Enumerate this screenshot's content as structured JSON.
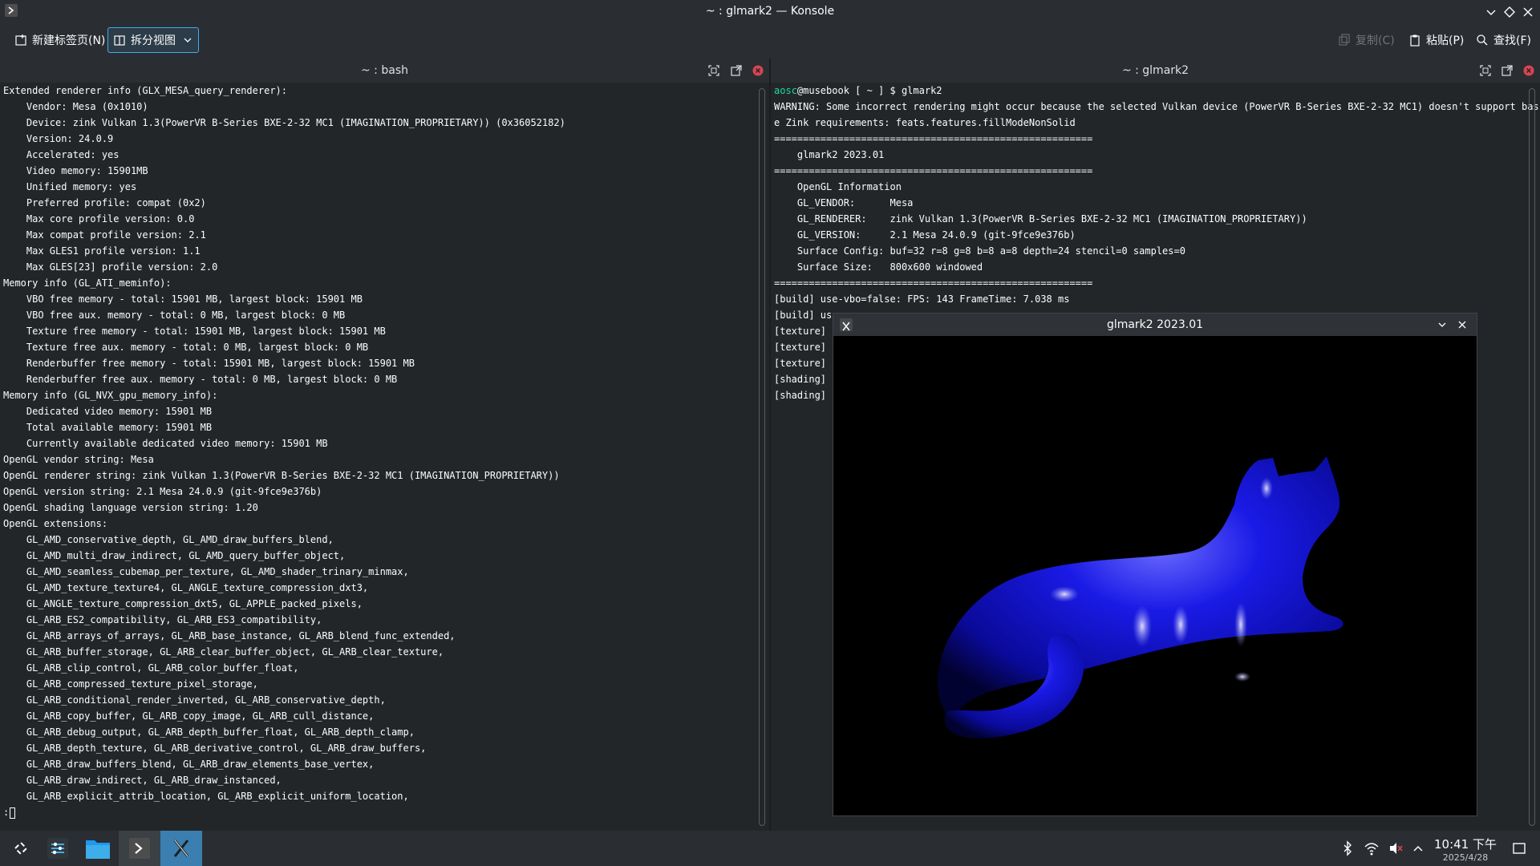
{
  "window": {
    "title": "~ : glmark2 — Konsole"
  },
  "toolbar": {
    "new_tab": "新建标签页(N)",
    "split_view": "拆分视图",
    "copy": "复制(C)",
    "paste": "粘贴(P)",
    "find": "查找(F)"
  },
  "left_pane": {
    "title": "~ : bash",
    "lines": [
      "Extended renderer info (GLX_MESA_query_renderer):",
      "    Vendor: Mesa (0x1010)",
      "    Device: zink Vulkan 1.3(PowerVR B-Series BXE-2-32 MC1 (IMAGINATION_PROPRIETARY)) (0x36052182)",
      "    Version: 24.0.9",
      "    Accelerated: yes",
      "    Video memory: 15901MB",
      "    Unified memory: yes",
      "    Preferred profile: compat (0x2)",
      "    Max core profile version: 0.0",
      "    Max compat profile version: 2.1",
      "    Max GLES1 profile version: 1.1",
      "    Max GLES[23] profile version: 2.0",
      "Memory info (GL_ATI_meminfo):",
      "    VBO free memory - total: 15901 MB, largest block: 15901 MB",
      "    VBO free aux. memory - total: 0 MB, largest block: 0 MB",
      "    Texture free memory - total: 15901 MB, largest block: 15901 MB",
      "    Texture free aux. memory - total: 0 MB, largest block: 0 MB",
      "    Renderbuffer free memory - total: 15901 MB, largest block: 15901 MB",
      "    Renderbuffer free aux. memory - total: 0 MB, largest block: 0 MB",
      "Memory info (GL_NVX_gpu_memory_info):",
      "    Dedicated video memory: 15901 MB",
      "    Total available memory: 15901 MB",
      "    Currently available dedicated video memory: 15901 MB",
      "OpenGL vendor string: Mesa",
      "OpenGL renderer string: zink Vulkan 1.3(PowerVR B-Series BXE-2-32 MC1 (IMAGINATION_PROPRIETARY))",
      "OpenGL version string: 2.1 Mesa 24.0.9 (git-9fce9e376b)",
      "OpenGL shading language version string: 1.20",
      "OpenGL extensions:",
      "    GL_AMD_conservative_depth, GL_AMD_draw_buffers_blend,",
      "    GL_AMD_multi_draw_indirect, GL_AMD_query_buffer_object,",
      "    GL_AMD_seamless_cubemap_per_texture, GL_AMD_shader_trinary_minmax,",
      "    GL_AMD_texture_texture4, GL_ANGLE_texture_compression_dxt3,",
      "    GL_ANGLE_texture_compression_dxt5, GL_APPLE_packed_pixels,",
      "    GL_ARB_ES2_compatibility, GL_ARB_ES3_compatibility,",
      "    GL_ARB_arrays_of_arrays, GL_ARB_base_instance, GL_ARB_blend_func_extended,",
      "    GL_ARB_buffer_storage, GL_ARB_clear_buffer_object, GL_ARB_clear_texture,",
      "    GL_ARB_clip_control, GL_ARB_color_buffer_float,",
      "    GL_ARB_compressed_texture_pixel_storage,",
      "    GL_ARB_conditional_render_inverted, GL_ARB_conservative_depth,",
      "    GL_ARB_copy_buffer, GL_ARB_copy_image, GL_ARB_cull_distance,",
      "    GL_ARB_debug_output, GL_ARB_depth_buffer_float, GL_ARB_depth_clamp,",
      "    GL_ARB_depth_texture, GL_ARB_derivative_control, GL_ARB_draw_buffers,",
      "    GL_ARB_draw_buffers_blend, GL_ARB_draw_elements_base_vertex,",
      "    GL_ARB_draw_indirect, GL_ARB_draw_instanced,",
      "    GL_ARB_explicit_attrib_location, GL_ARB_explicit_uniform_location,",
      ":"
    ]
  },
  "right_pane": {
    "title": "~ : glmark2",
    "prompt_user": "aosc",
    "prompt_rest": "@musebook [ ~ ] $ glmark2",
    "lines": [
      "WARNING: Some incorrect rendering might occur because the selected Vulkan device (PowerVR B-Series BXE-2-32 MC1) doesn't support bas",
      "e Zink requirements: feats.features.fillModeNonSolid",
      "=======================================================",
      "    glmark2 2023.01",
      "=======================================================",
      "    OpenGL Information",
      "    GL_VENDOR:      Mesa",
      "    GL_RENDERER:    zink Vulkan 1.3(PowerVR B-Series BXE-2-32 MC1 (IMAGINATION_PROPRIETARY))",
      "    GL_VERSION:     2.1 Mesa 24.0.9 (git-9fce9e376b)",
      "    Surface Config: buf=32 r=8 g=8 b=8 a=8 depth=24 stencil=0 samples=0",
      "    Surface Size:   800x600 windowed",
      "=======================================================",
      "[build] use-vbo=false: FPS: 143 FrameTime: 7.038 ms",
      "[build] use",
      "[texture] t",
      "[texture] t",
      "[texture] t",
      "[shading] s",
      "[shading] s"
    ]
  },
  "glmark_window": {
    "title": "glmark2 2023.01"
  },
  "clock": {
    "time": "10:41 下午",
    "date": "2025/4/28"
  },
  "colors": {
    "accent": "#3daee9",
    "prompt_user": "#1cdc9a",
    "model_blue": "#1a1adc"
  }
}
